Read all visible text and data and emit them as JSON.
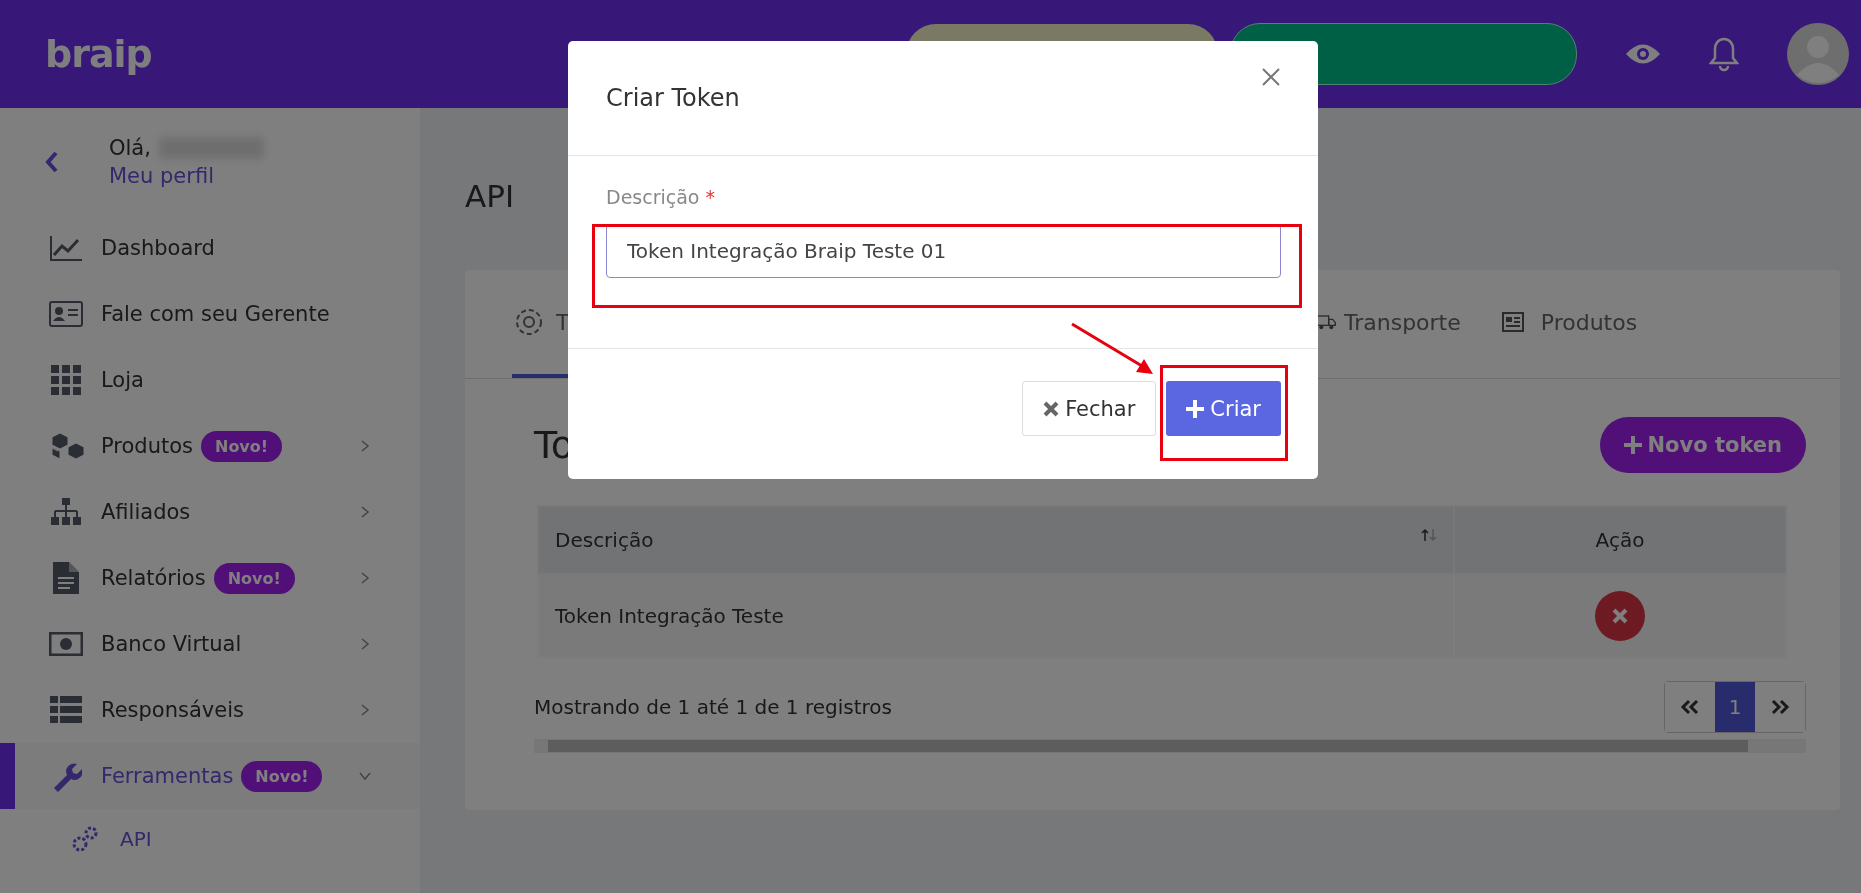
{
  "topbar": {
    "logo": "braip"
  },
  "sidebar": {
    "greeting": "Olá,",
    "profile_link": "Meu perfil",
    "items": [
      {
        "label": "Dashboard",
        "selected": false
      },
      {
        "label": "Fale com seu Gerente",
        "selected": false
      },
      {
        "label": "Loja",
        "selected": false
      },
      {
        "label": "Produtos",
        "badge": "Novo!",
        "expanded": false,
        "selected": false
      },
      {
        "label": "Afiliados",
        "expanded": false,
        "selected": false
      },
      {
        "label": "Relatórios",
        "badge": "Novo!",
        "expanded": false,
        "selected": false
      },
      {
        "label": "Banco Virtual",
        "expanded": false,
        "selected": false
      },
      {
        "label": "Responsáveis",
        "expanded": false,
        "selected": false
      },
      {
        "label": "Ferramentas",
        "badge": "Novo!",
        "expanded": true,
        "selected": true,
        "children": [
          {
            "label": "API",
            "selected": true
          }
        ]
      }
    ]
  },
  "main": {
    "title": "API",
    "tabs": [
      {
        "label": "T",
        "selected": true
      },
      {
        "label": "Transporte",
        "selected": false
      },
      {
        "label": "Produtos",
        "selected": false
      }
    ],
    "section_title": "To",
    "new_button": "Novo token",
    "table": {
      "columns": [
        "Descrição",
        "Ação"
      ],
      "rows": [
        {
          "description": "Token Integração Teste"
        }
      ]
    },
    "footer_text": "Mostrando de 1 até 1 de 1 registros",
    "pagination": {
      "pages": [
        {
          "label": "1",
          "selected": true
        }
      ]
    }
  },
  "modal": {
    "title": "Criar Token",
    "field": {
      "label": "Descrição",
      "required_mark": "*",
      "value": "Token Integração Braip Teste 01"
    },
    "buttons": [
      {
        "label": "Fechar",
        "kind": "secondary"
      },
      {
        "label": "Criar",
        "kind": "primary"
      }
    ]
  }
}
